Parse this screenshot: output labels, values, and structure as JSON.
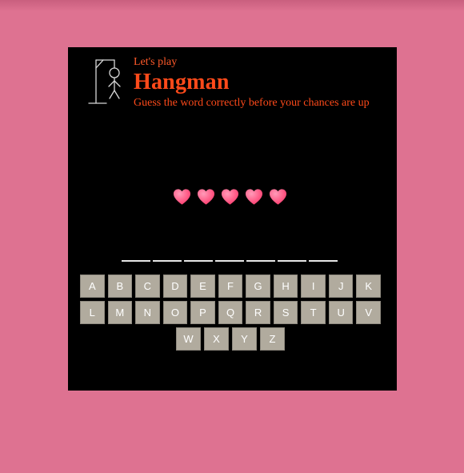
{
  "header": {
    "pre_title": "Let's play",
    "title": "Hangman",
    "subtitle": "Guess the word correctly before your chances are up",
    "logo_icon": "hangman-gallows-icon"
  },
  "lives": {
    "count": 5,
    "icon": "heart-icon",
    "color": "#ff3c6e"
  },
  "word": {
    "length": 7,
    "revealed": [
      "",
      "",
      "",
      "",
      "",
      "",
      ""
    ]
  },
  "keyboard": {
    "rows": [
      [
        "A",
        "B",
        "C",
        "D",
        "E",
        "F",
        "G",
        "H",
        "I",
        "J",
        "K"
      ],
      [
        "L",
        "M",
        "N",
        "O",
        "P",
        "Q",
        "R",
        "S",
        "T",
        "U",
        "V"
      ],
      [
        "W",
        "X",
        "Y",
        "Z"
      ]
    ]
  },
  "colors": {
    "page_background": "#de7291",
    "card_background": "#000000",
    "title_color": "#ff4a1a",
    "key_background": "#b1ab9e"
  }
}
